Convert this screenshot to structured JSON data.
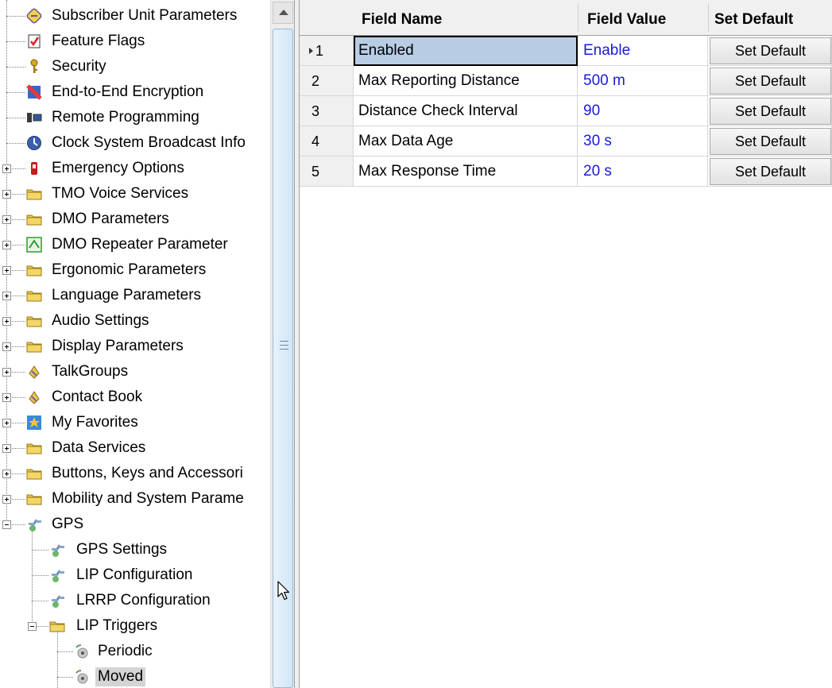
{
  "tree": {
    "items": [
      {
        "label": "Subscriber Unit Parameters",
        "icon": "subscriber-unit-icon",
        "level": 1,
        "expander": "none"
      },
      {
        "label": "Feature Flags",
        "icon": "feature-flags-icon",
        "level": 1,
        "expander": "none"
      },
      {
        "label": "Security",
        "icon": "key-icon",
        "level": 1,
        "expander": "none"
      },
      {
        "label": "End-to-End Encryption",
        "icon": "encryption-icon",
        "level": 1,
        "expander": "none"
      },
      {
        "label": "Remote Programming",
        "icon": "remote-programming-icon",
        "level": 1,
        "expander": "none"
      },
      {
        "label": "Clock System Broadcast Info",
        "icon": "clock-icon",
        "level": 1,
        "expander": "none"
      },
      {
        "label": "Emergency Options",
        "icon": "emergency-icon",
        "level": 1,
        "expander": "plus"
      },
      {
        "label": "TMO Voice Services",
        "icon": "folder-icon",
        "level": 1,
        "expander": "plus"
      },
      {
        "label": "DMO Parameters",
        "icon": "folder-icon",
        "level": 1,
        "expander": "plus"
      },
      {
        "label": "DMO Repeater Parameter",
        "icon": "repeater-icon",
        "level": 1,
        "expander": "plus"
      },
      {
        "label": "Ergonomic Parameters",
        "icon": "folder-icon",
        "level": 1,
        "expander": "plus"
      },
      {
        "label": "Language Parameters",
        "icon": "folder-icon",
        "level": 1,
        "expander": "plus"
      },
      {
        "label": "Audio Settings",
        "icon": "folder-icon",
        "level": 1,
        "expander": "plus"
      },
      {
        "label": "Display Parameters",
        "icon": "folder-icon",
        "level": 1,
        "expander": "plus"
      },
      {
        "label": "TalkGroups",
        "icon": "talkgroups-icon",
        "level": 1,
        "expander": "plus"
      },
      {
        "label": "Contact Book",
        "icon": "contact-book-icon",
        "level": 1,
        "expander": "plus"
      },
      {
        "label": "My Favorites",
        "icon": "favorites-star-icon",
        "level": 1,
        "expander": "plus"
      },
      {
        "label": "Data Services",
        "icon": "folder-icon",
        "level": 1,
        "expander": "plus"
      },
      {
        "label": "Buttons, Keys and Accessori",
        "icon": "folder-icon",
        "level": 1,
        "expander": "plus"
      },
      {
        "label": "Mobility and System Parame",
        "icon": "folder-icon",
        "level": 1,
        "expander": "plus"
      },
      {
        "label": "GPS",
        "icon": "gps-satellite-icon",
        "level": 1,
        "expander": "minus"
      },
      {
        "label": "GPS Settings",
        "icon": "gps-satellite-icon",
        "level": 2,
        "expander": "none"
      },
      {
        "label": "LIP Configuration",
        "icon": "gps-satellite-icon",
        "level": 2,
        "expander": "none"
      },
      {
        "label": "LRRP Configuration",
        "icon": "gps-satellite-icon",
        "level": 2,
        "expander": "none"
      },
      {
        "label": "LIP Triggers",
        "icon": "folder-icon",
        "level": 2,
        "expander": "minus"
      },
      {
        "label": "Periodic",
        "icon": "trigger-icon",
        "level": 3,
        "expander": "none"
      },
      {
        "label": "Moved",
        "icon": "trigger-icon",
        "level": 3,
        "expander": "none",
        "selected": true
      }
    ]
  },
  "grid": {
    "headers": {
      "field_name": "Field Name",
      "field_value": "Field Value",
      "set_default": "Set Default"
    },
    "rows": [
      {
        "num": "1",
        "name": "Enabled",
        "value": "Enable",
        "button": "Set Default"
      },
      {
        "num": "2",
        "name": "Max Reporting Distance",
        "value": "500 m",
        "button": "Set Default"
      },
      {
        "num": "3",
        "name": "Distance Check Interval",
        "value": "90",
        "button": "Set Default"
      },
      {
        "num": "4",
        "name": "Max Data Age",
        "value": "30 s",
        "button": "Set Default"
      },
      {
        "num": "5",
        "name": "Max Response Time",
        "value": "20 s",
        "button": "Set Default"
      }
    ],
    "current_row": "1"
  },
  "colors": {
    "value_text": "#1a1ad9",
    "selected_cell": "#b8cce4",
    "selected_tree_item": "#d4d4d4",
    "folder": "#e8c84a"
  }
}
